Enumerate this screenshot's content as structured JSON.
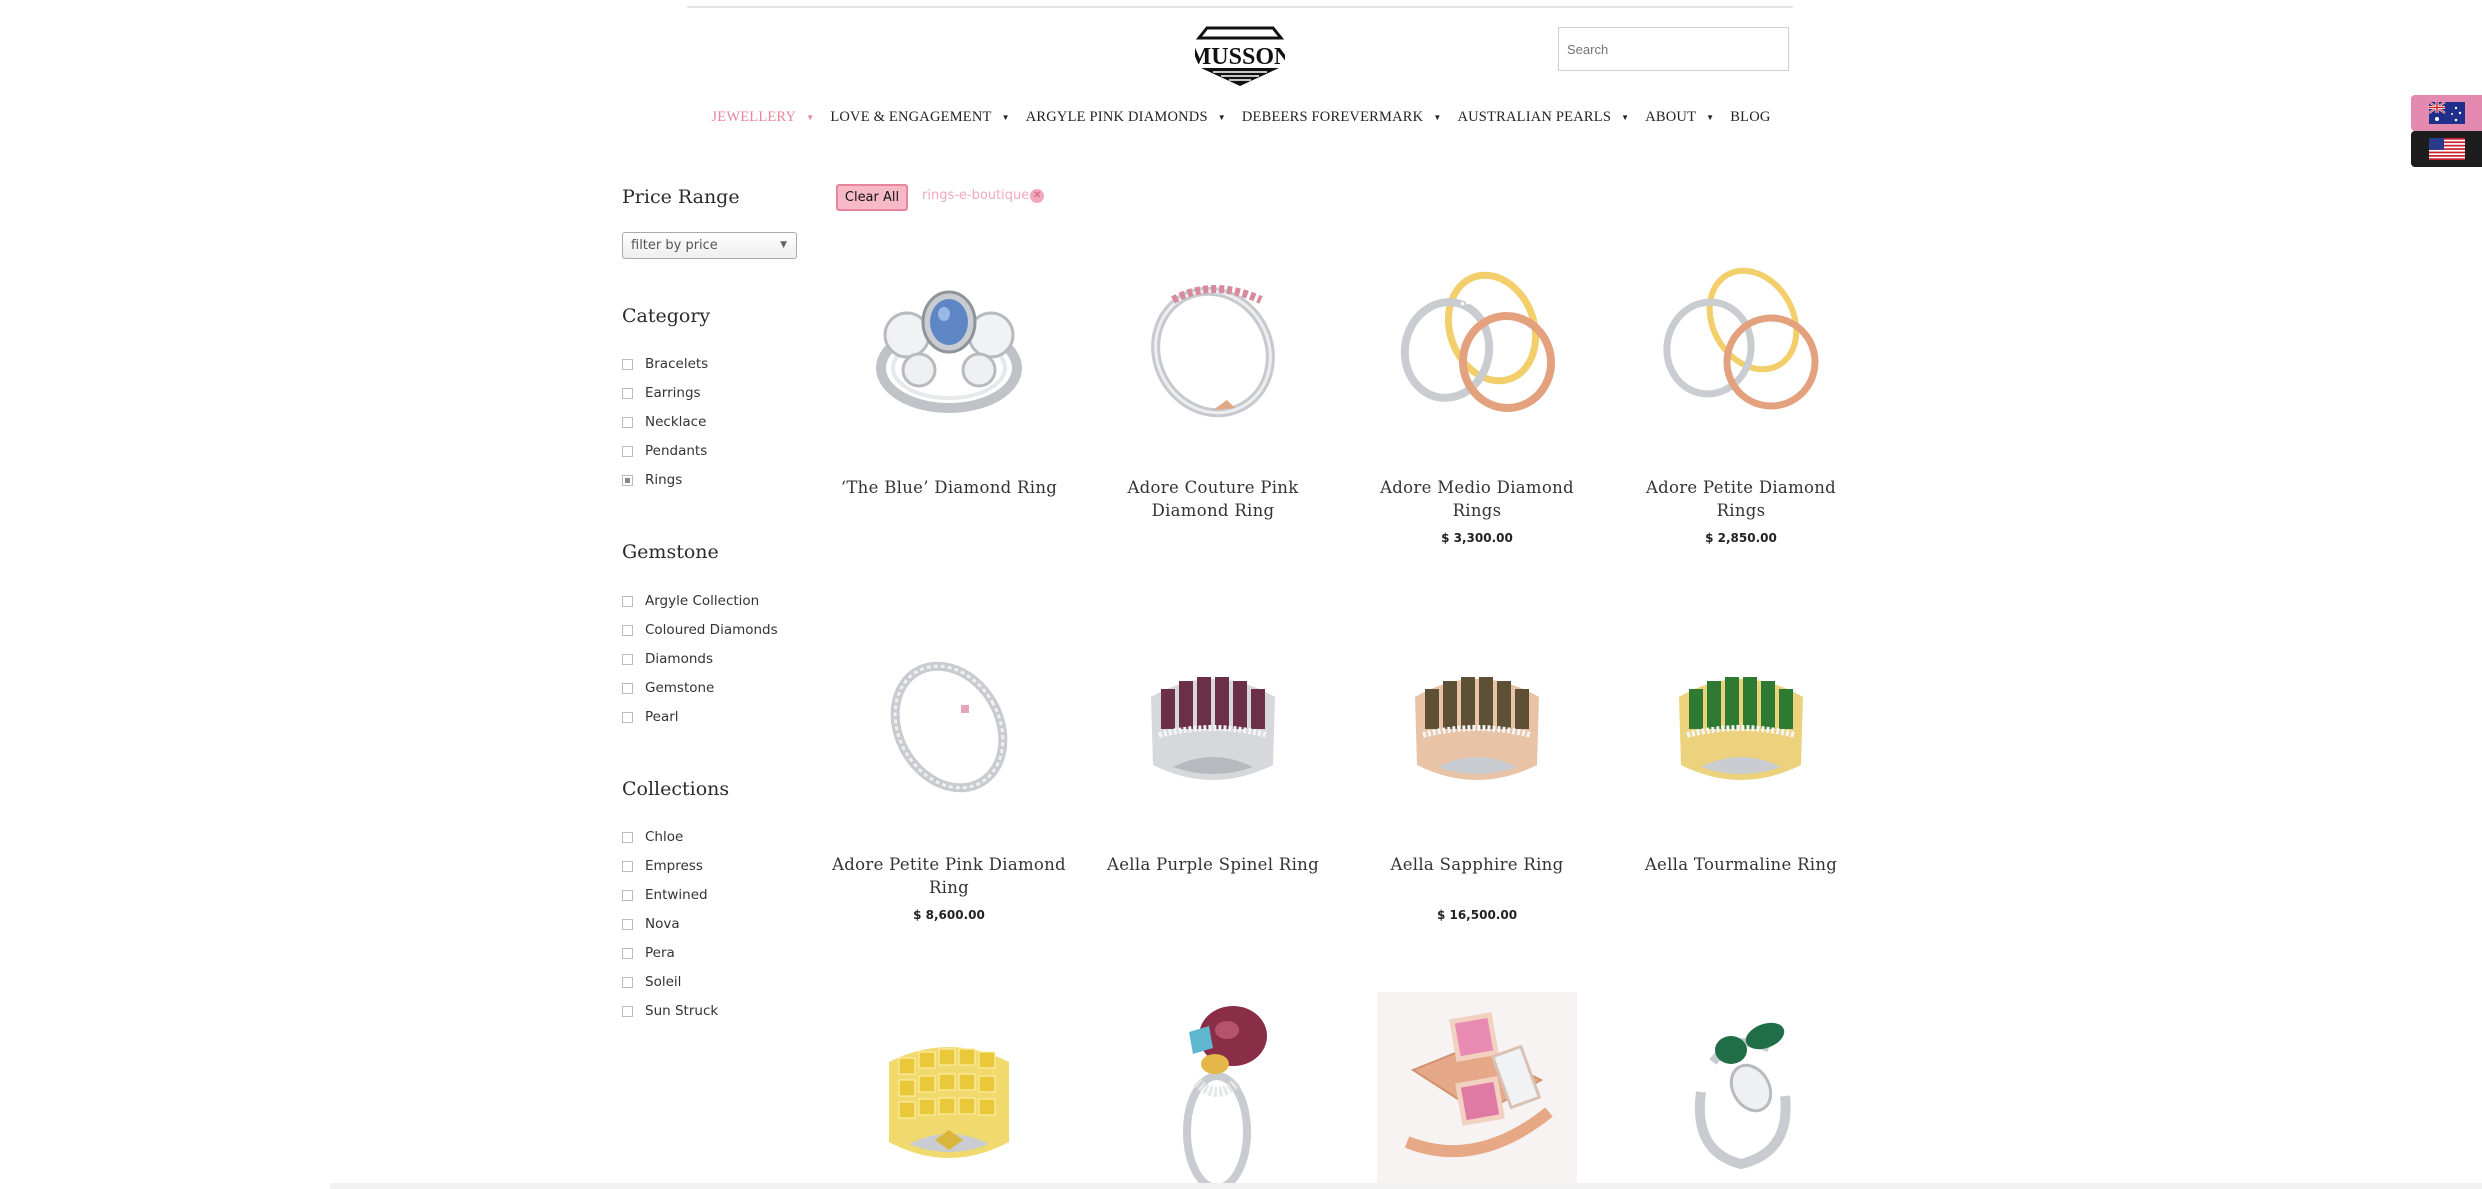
{
  "header": {
    "logo_text": "MUSSON",
    "search_placeholder": "Search"
  },
  "nav": [
    {
      "label": "JEWELLERY",
      "has_menu": true,
      "active": true
    },
    {
      "label": "LOVE & ENGAGEMENT",
      "has_menu": true
    },
    {
      "label": "ARGYLE PINK DIAMONDS",
      "has_menu": true
    },
    {
      "label": "DEBEERS FOREVERMARK",
      "has_menu": true
    },
    {
      "label": "AUSTRALIAN PEARLS",
      "has_menu": true
    },
    {
      "label": "ABOUT",
      "has_menu": true
    },
    {
      "label": "BLOG",
      "has_menu": false
    }
  ],
  "flags": [
    "australia-flag-icon",
    "usa-flag-icon"
  ],
  "filters": {
    "price": {
      "title": "Price Range",
      "select": "filter by price"
    },
    "category": {
      "title": "Category",
      "options": [
        "Bracelets",
        "Earrings",
        "Necklace",
        "Pendants",
        "Rings"
      ],
      "checked": [
        "Rings"
      ]
    },
    "gemstone": {
      "title": "Gemstone",
      "options": [
        "Argyle Collection",
        "Coloured Diamonds",
        "Diamonds",
        "Gemstone",
        "Pearl"
      ]
    },
    "collections": {
      "title": "Collections",
      "options": [
        "Chloe",
        "Empress",
        "Entwined",
        "Nova",
        "Pera",
        "Soleil",
        "Sun Struck"
      ]
    }
  },
  "active_filters": {
    "clear_label": "Clear All",
    "tag": "rings-e-boutique"
  },
  "products": [
    {
      "name": "‘The Blue’ Diamond Ring",
      "price": "",
      "image": "blue-diamond-ring"
    },
    {
      "name": "Adore Couture Pink Diamond Ring",
      "price": "",
      "image": "pink-eternity-band"
    },
    {
      "name": "Adore Medio Diamond Rings",
      "price": "$ 3,300.00",
      "image": "three-stacked-bands"
    },
    {
      "name": "Adore Petite Diamond Rings",
      "price": "$ 2,850.00",
      "image": "three-stacked-bands-petite"
    },
    {
      "name": "Adore Petite Pink Diamond Ring",
      "price": "$ 8,600.00",
      "image": "petite-pink-band"
    },
    {
      "name": "Aella Purple Spinel Ring",
      "price": "",
      "image": "purple-baguette-ring"
    },
    {
      "name": "Aella Sapphire Ring",
      "price": "$ 16,500.00",
      "image": "olive-baguette-ring"
    },
    {
      "name": "Aella Tourmaline Ring",
      "price": "",
      "image": "green-baguette-ring"
    },
    {
      "name": "",
      "price": "",
      "image": "yellow-diamond-ring"
    },
    {
      "name": "",
      "price": "",
      "image": "multi-gem-cocktail-ring"
    },
    {
      "name": "",
      "price": "",
      "image": "pink-geometric-ring"
    },
    {
      "name": "",
      "price": "",
      "image": "emerald-toi-et-moi-ring"
    }
  ],
  "colors": {
    "accent": "#e7859d",
    "clear_bg": "#f7b9c8",
    "flag_au_bg": "#e48ab1",
    "flag_us_bg": "#1d1d1d"
  }
}
